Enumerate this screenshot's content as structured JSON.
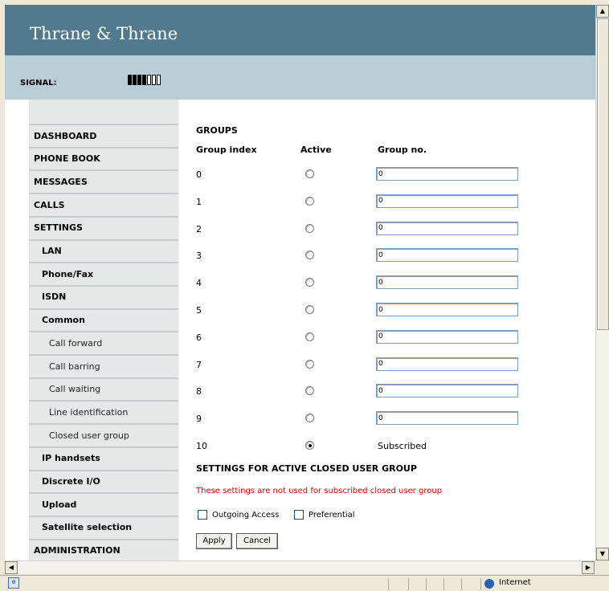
{
  "brand": "Thrane & Thrane",
  "signal": {
    "label": "SIGNAL:",
    "level": 4,
    "max": 7
  },
  "nav": [
    {
      "label": "DASHBOARD",
      "level": 1
    },
    {
      "label": "PHONE BOOK",
      "level": 1
    },
    {
      "label": "MESSAGES",
      "level": 1
    },
    {
      "label": "CALLS",
      "level": 1
    },
    {
      "label": "SETTINGS",
      "level": 1
    },
    {
      "label": "LAN",
      "level": 2
    },
    {
      "label": "Phone/Fax",
      "level": 2
    },
    {
      "label": "ISDN",
      "level": 2
    },
    {
      "label": "Common",
      "level": 2
    },
    {
      "label": "Call forward",
      "level": 3
    },
    {
      "label": "Call barring",
      "level": 3
    },
    {
      "label": "Call waiting",
      "level": 3
    },
    {
      "label": "Line identification",
      "level": 3
    },
    {
      "label": "Closed user group",
      "level": 3
    },
    {
      "label": "IP handsets",
      "level": 2
    },
    {
      "label": "Discrete I/O",
      "level": 2
    },
    {
      "label": "Upload",
      "level": 2
    },
    {
      "label": "Satellite selection",
      "level": 2
    },
    {
      "label": "ADMINISTRATION",
      "level": 1
    }
  ],
  "groups": {
    "title": "GROUPS",
    "headers": {
      "index": "Group index",
      "active": "Active",
      "group_no": "Group no."
    },
    "rows": [
      {
        "index": "0",
        "active": false,
        "value": "0"
      },
      {
        "index": "1",
        "active": false,
        "value": "0"
      },
      {
        "index": "2",
        "active": false,
        "value": "0"
      },
      {
        "index": "3",
        "active": false,
        "value": "0"
      },
      {
        "index": "4",
        "active": false,
        "value": "0"
      },
      {
        "index": "5",
        "active": false,
        "value": "0"
      },
      {
        "index": "6",
        "active": false,
        "value": "0"
      },
      {
        "index": "7",
        "active": false,
        "value": "0"
      },
      {
        "index": "8",
        "active": false,
        "value": "0"
      },
      {
        "index": "9",
        "active": false,
        "value": "0"
      },
      {
        "index": "10",
        "active": true,
        "value": "Subscribed"
      }
    ]
  },
  "active_settings": {
    "title": "SETTINGS FOR ACTIVE CLOSED USER GROUP",
    "warning": "These settings are not used for subscribed closed user group",
    "warning_color": "#e00000",
    "outgoing_access": "Outgoing Access",
    "preferential": "Preferential"
  },
  "buttons": {
    "apply": "Apply",
    "cancel": "Cancel"
  },
  "status": {
    "zone": "Internet"
  },
  "colors": {
    "header": "#527a8e",
    "signal_bar": "#b8cdd6",
    "nav": "#e6e8e8"
  }
}
